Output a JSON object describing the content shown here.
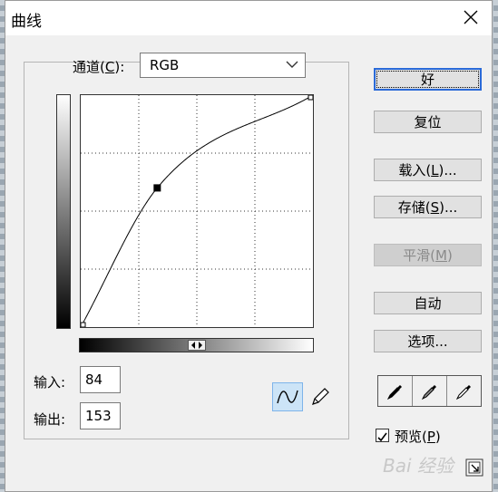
{
  "window": {
    "title": "曲线"
  },
  "channel": {
    "label": "通道(",
    "accel": "C",
    "suffix": "):",
    "value": "RGB"
  },
  "curve": {
    "input_range": [
      0,
      255
    ],
    "output_range": [
      0,
      255
    ],
    "points": [
      [
        0,
        0
      ],
      [
        84,
        153
      ],
      [
        255,
        255
      ]
    ]
  },
  "input": {
    "label": "输入:",
    "value": "84"
  },
  "output": {
    "label": "输出:",
    "value": "153"
  },
  "buttons": {
    "ok": "好",
    "reset": "复位",
    "load": {
      "pre": "载入(",
      "accel": "L",
      "post": ")..."
    },
    "save": {
      "pre": "存储(",
      "accel": "S",
      "post": ")..."
    },
    "smooth": {
      "pre": "平滑(",
      "accel": "M",
      "post": ")"
    },
    "auto": "自动",
    "options": "选项..."
  },
  "preview": {
    "pre": "预览(",
    "accel": "P",
    "post": ")",
    "checked": true
  },
  "icons": {
    "close": "close-icon",
    "curve_tool": "curve-tool-icon",
    "pencil_tool": "pencil-tool-icon",
    "black_dropper": "black-eyedropper-icon",
    "gray_dropper": "gray-eyedropper-icon",
    "white_dropper": "white-eyedropper-icon",
    "expand": "expand-icon"
  },
  "watermark": "Bai 经验"
}
